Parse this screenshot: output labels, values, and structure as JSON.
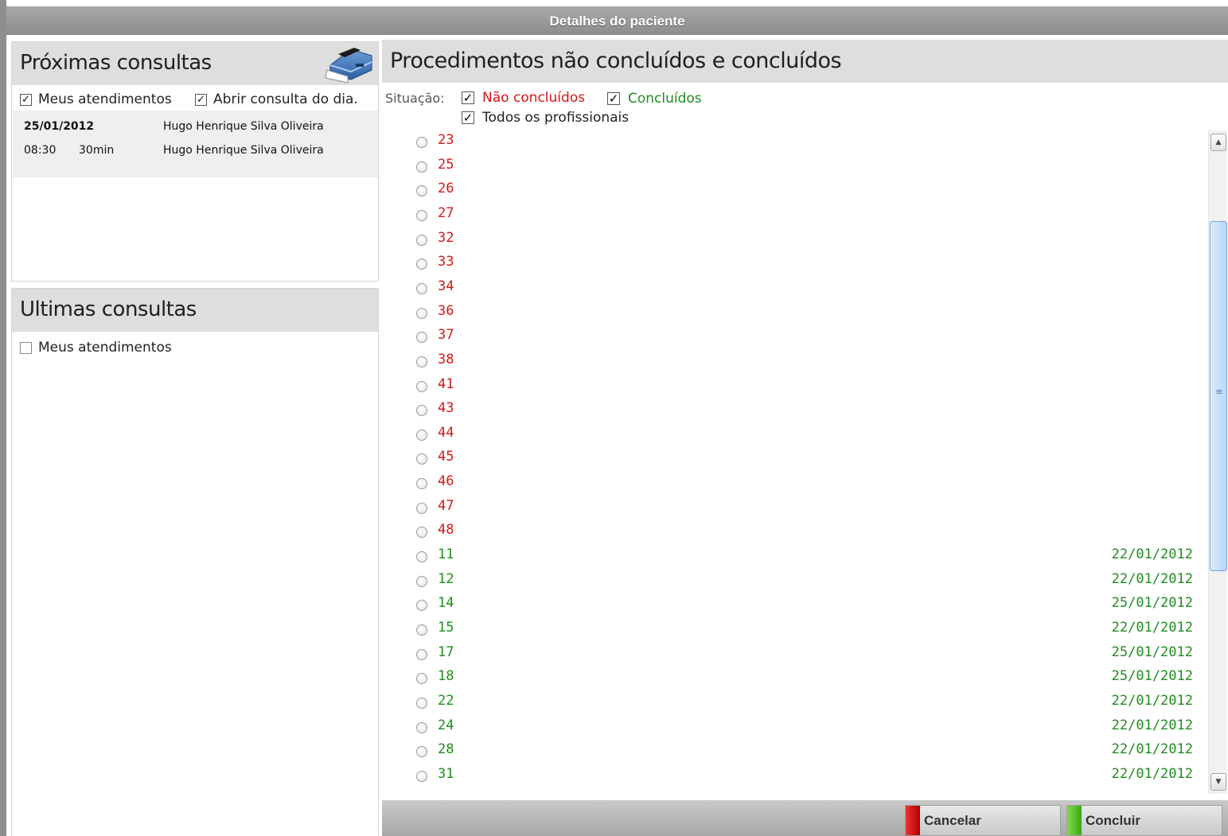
{
  "window": {
    "title": "Detalhes do paciente"
  },
  "next_appointments": {
    "title": "Próximas consultas",
    "print_icon": "printer-icon",
    "my_appointments_label": "Meus atendimentos",
    "my_appointments_checked": true,
    "open_today_label": "Abrir consulta do dia.",
    "open_today_checked": true,
    "date": "25/01/2012",
    "date_professional": "Hugo Henrique Silva Oliveira",
    "time": "08:30",
    "duration": "30min",
    "professional": "Hugo Henrique Silva Oliveira"
  },
  "last_appointments": {
    "title": "Ultimas consultas",
    "my_appointments_label": "Meus atendimentos",
    "my_appointments_checked": false
  },
  "procedures": {
    "title": "Procedimentos não concluídos e concluídos",
    "situation_label": "Situação:",
    "filter_not_done_label": "Não concluídos",
    "filter_done_label": "Concluídos",
    "filter_all_professionals_label": "Todos os profissionais",
    "colors": {
      "not_done": "#d31818",
      "done": "#1f8c1f"
    },
    "items": [
      {
        "number": "23",
        "status": "not_done",
        "date": ""
      },
      {
        "number": "25",
        "status": "not_done",
        "date": ""
      },
      {
        "number": "26",
        "status": "not_done",
        "date": ""
      },
      {
        "number": "27",
        "status": "not_done",
        "date": ""
      },
      {
        "number": "32",
        "status": "not_done",
        "date": ""
      },
      {
        "number": "33",
        "status": "not_done",
        "date": ""
      },
      {
        "number": "34",
        "status": "not_done",
        "date": ""
      },
      {
        "number": "36",
        "status": "not_done",
        "date": ""
      },
      {
        "number": "37",
        "status": "not_done",
        "date": ""
      },
      {
        "number": "38",
        "status": "not_done",
        "date": ""
      },
      {
        "number": "41",
        "status": "not_done",
        "date": ""
      },
      {
        "number": "43",
        "status": "not_done",
        "date": ""
      },
      {
        "number": "44",
        "status": "not_done",
        "date": ""
      },
      {
        "number": "45",
        "status": "not_done",
        "date": ""
      },
      {
        "number": "46",
        "status": "not_done",
        "date": ""
      },
      {
        "number": "47",
        "status": "not_done",
        "date": ""
      },
      {
        "number": "48",
        "status": "not_done",
        "date": ""
      },
      {
        "number": "11",
        "status": "done",
        "date": "22/01/2012"
      },
      {
        "number": "12",
        "status": "done",
        "date": "22/01/2012"
      },
      {
        "number": "14",
        "status": "done",
        "date": "25/01/2012"
      },
      {
        "number": "15",
        "status": "done",
        "date": "22/01/2012"
      },
      {
        "number": "17",
        "status": "done",
        "date": "25/01/2012"
      },
      {
        "number": "18",
        "status": "done",
        "date": "25/01/2012"
      },
      {
        "number": "22",
        "status": "done",
        "date": "22/01/2012"
      },
      {
        "number": "24",
        "status": "done",
        "date": "22/01/2012"
      },
      {
        "number": "28",
        "status": "done",
        "date": "22/01/2012"
      },
      {
        "number": "31",
        "status": "done",
        "date": "22/01/2012"
      }
    ]
  },
  "footer": {
    "cancel_label": "Cancelar",
    "confirm_label": "Concluir"
  }
}
